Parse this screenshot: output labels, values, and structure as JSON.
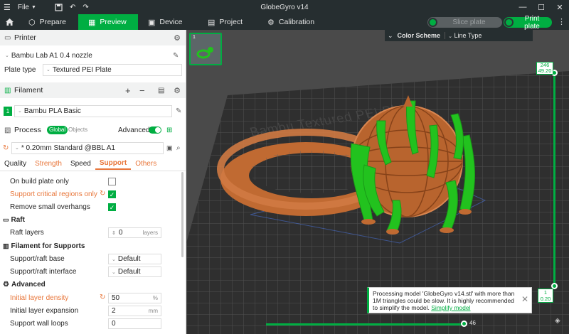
{
  "titlebar": {
    "menu_label": "File",
    "title": "GlobeGyro v14"
  },
  "tabs": [
    {
      "label": "Prepare"
    },
    {
      "label": "Preview"
    },
    {
      "label": "Device"
    },
    {
      "label": "Project"
    },
    {
      "label": "Calibration"
    }
  ],
  "actions": {
    "slice_label": "Slice plate",
    "print_label": "Print plate"
  },
  "printer": {
    "section_label": "Printer",
    "printer_name": "Bambu Lab A1 0.4 nozzle",
    "plate_type_label": "Plate type",
    "plate_type_value": "Textured PEI Plate"
  },
  "filament": {
    "section_label": "Filament",
    "slot_number": "1",
    "filament_name": "Bambu PLA Basic"
  },
  "process": {
    "section_label": "Process",
    "global_label": "Global",
    "objects_label": "Objects",
    "advanced_label": "Advanced",
    "preset_name": "* 0.20mm Standard @BBL A1",
    "subtabs": [
      "Quality",
      "Strength",
      "Speed",
      "Support",
      "Others"
    ]
  },
  "support_settings": {
    "on_build_plate_only": "On build plate only",
    "support_critical_regions_only": "Support critical regions only",
    "remove_small_overhangs": "Remove small overhangs"
  },
  "raft": {
    "heading": "Raft",
    "raft_layers_label": "Raft layers",
    "raft_layers_value": "0",
    "raft_layers_unit": "layers"
  },
  "filament_for_supports": {
    "heading": "Filament for Supports",
    "base_label": "Support/raft base",
    "base_value": "Default",
    "interface_label": "Support/raft interface",
    "interface_value": "Default"
  },
  "advanced": {
    "heading": "Advanced",
    "initial_layer_density_label": "Initial layer density",
    "initial_layer_density_value": "50",
    "initial_layer_density_unit": "%",
    "initial_layer_expansion_label": "Initial layer expansion",
    "initial_layer_expansion_value": "2",
    "initial_layer_expansion_unit": "mm",
    "support_wall_loops_label": "Support wall loops",
    "support_wall_loops_value": "0"
  },
  "viewport": {
    "plate_number": "1",
    "color_scheme_label": "Color Scheme",
    "color_scheme_value": "Line Type",
    "bed_text": "Bambu Textured PEI Plate",
    "layer_top_index": "246",
    "layer_top_height": "49.20",
    "layer_bottom_index": "1",
    "layer_bottom_height": "0.20",
    "move_value": "46"
  },
  "notification": {
    "message": "Processing model 'GlobeGyro v14.stl' with more than 1M triangles could be slow. It is highly recommended to simplify the model.",
    "link_label": "Simplify model"
  },
  "colors": {
    "accent": "#00ae42",
    "model": "#c06a32",
    "support": "#22c21e",
    "highlight_text": "#e8763a"
  }
}
